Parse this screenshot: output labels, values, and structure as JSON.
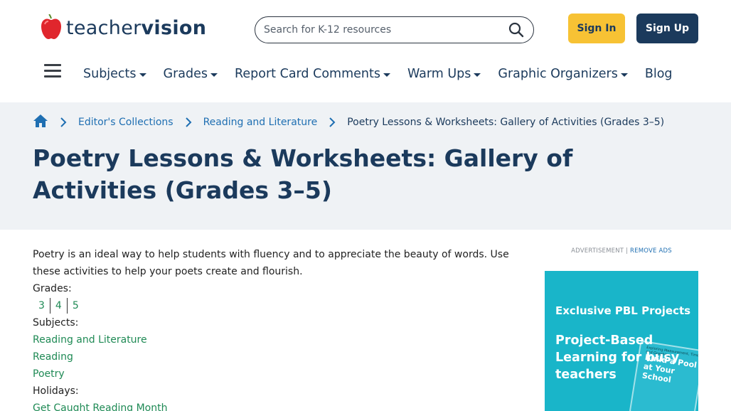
{
  "header": {
    "logo": {
      "word1": "teacher",
      "word2": "vision"
    },
    "search": {
      "placeholder": "Search for K-12 resources"
    },
    "sign_in": "Sign In",
    "sign_up": "Sign Up"
  },
  "nav": {
    "items": [
      {
        "label": "Subjects",
        "dropdown": true
      },
      {
        "label": "Grades",
        "dropdown": true
      },
      {
        "label": "Report Card Comments",
        "dropdown": true
      },
      {
        "label": "Warm Ups",
        "dropdown": true
      },
      {
        "label": "Graphic Organizers",
        "dropdown": true
      },
      {
        "label": "Blog",
        "dropdown": false
      }
    ]
  },
  "breadcrumb": {
    "items": [
      "Editor's Collections",
      "Reading and Literature"
    ],
    "current": "Poetry Lessons & Worksheets: Gallery of Activities (Grades 3–5)"
  },
  "page": {
    "title": "Poetry Lessons & Worksheets: Gallery of Activities (Grades 3–5)",
    "intro": "Poetry is an ideal way to help students with fluency and to appreciate the beauty of words. Use these activities to help your poets create and flourish.",
    "grades_label": "Grades:",
    "grades": [
      "3",
      "4",
      "5"
    ],
    "subjects_label": "Subjects:",
    "subjects": [
      "Reading and Literature",
      "Reading",
      "Poetry"
    ],
    "holidays_label": "Holidays:",
    "holidays": [
      "Get Caught Reading Month"
    ]
  },
  "ad": {
    "label": "ADVERTISEMENT |",
    "remove": "REMOVE ADS",
    "headline": "Exclusive PBL Projects",
    "subhead": "Project-Based Learning for busy teachers",
    "doc_small": "Exploring Measurement, Time and Graphing",
    "doc_title": "Build a Pool at Your School"
  },
  "colors": {
    "brand_navy": "#1b3a5c",
    "sign_in_bg": "#f7c234",
    "link_green": "#1f8a55",
    "link_blue": "#1f6fb2",
    "hero_bg": "#eff2f5",
    "ad_bg": "#19b5c9",
    "logo_apple": "#e0262d"
  }
}
